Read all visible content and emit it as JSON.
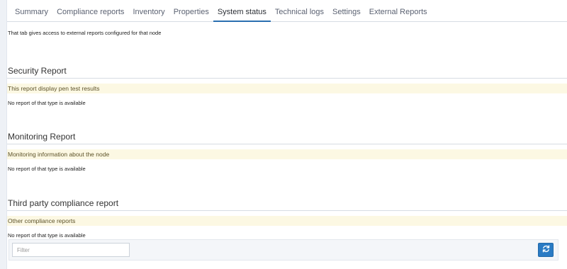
{
  "tabs": [
    {
      "label": "Summary",
      "active": false
    },
    {
      "label": "Compliance reports",
      "active": false
    },
    {
      "label": "Inventory",
      "active": false
    },
    {
      "label": "Properties",
      "active": false
    },
    {
      "label": "System status",
      "active": true
    },
    {
      "label": "Technical logs",
      "active": false
    },
    {
      "label": "Settings",
      "active": false
    },
    {
      "label": "External Reports",
      "active": false
    }
  ],
  "intro_text": "That tab gives access to external reports configured for that node",
  "sections": [
    {
      "title": "Security Report",
      "banner": "This report display pen test results",
      "empty_note": "No report of that type is available"
    },
    {
      "title": "Monitoring Report",
      "banner": "Monitoring information about the node",
      "empty_note": "No report of that type is available"
    },
    {
      "title": "Third party compliance report",
      "banner": "Other compliance reports",
      "empty_note": "No report of that type is available"
    }
  ],
  "table": {
    "filter_placeholder": "Filter",
    "filter_value": "",
    "refresh_icon": "refresh-icon"
  },
  "colors": {
    "active_tab_underline": "#2a6fb0",
    "banner_bg": "#fcf8e3",
    "refresh_button": "#2a7bc4"
  }
}
